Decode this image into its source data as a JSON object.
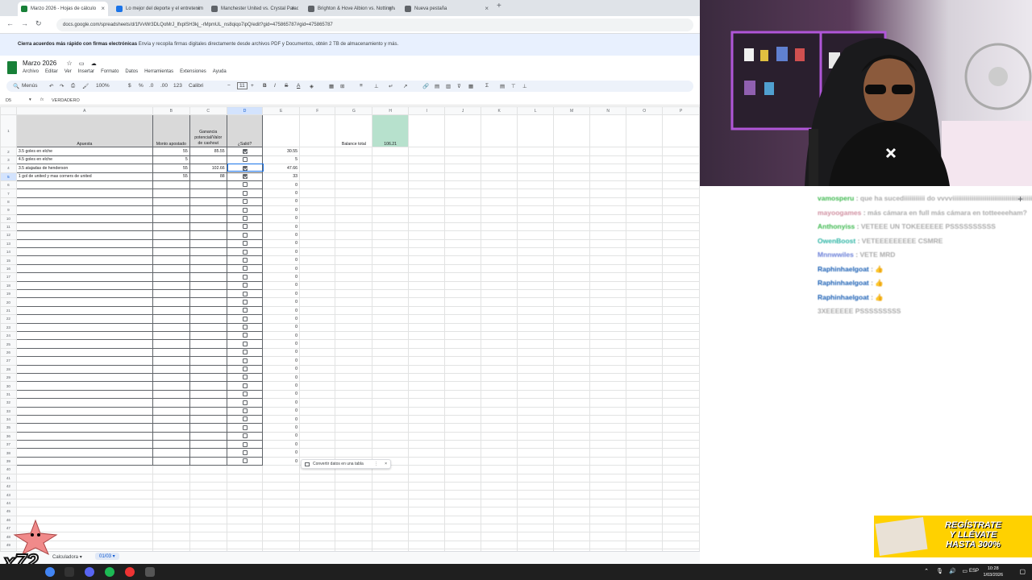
{
  "browser": {
    "tabs": [
      {
        "label": "Marzo 2026 - Hojas de cálculo",
        "active": true,
        "icon": "sheets-icon",
        "color": "#188038"
      },
      {
        "label": "Lo mejor del deporte y el entretenimiento",
        "active": false,
        "icon": "globe-icon",
        "color": "#1a73e8"
      },
      {
        "label": "Manchester United vs. Crystal Palace",
        "active": false,
        "icon": "globe-icon",
        "color": "#5f6368"
      },
      {
        "label": "Brighton & Hove Albion vs. Nottingham",
        "active": false,
        "icon": "globe-icon",
        "color": "#5f6368"
      },
      {
        "label": "Nueva pestaña",
        "active": false,
        "icon": "globe-icon",
        "color": "#5f6368"
      }
    ],
    "new_tab": "+",
    "url": "docs.google.com/spreadsheets/d/1fVvWr3DLQoMrJ_lfxplSH3kj_-rMpmUL_ns8qiqo7ipQ/edit?gid=475865787#gid=475865787"
  },
  "notice": {
    "bold": "Cierra acuerdos más rápido con firmas electrónicas",
    "text": "Envía y recopila firmas digitales directamente desde archivos PDF y Documentos, obtén 2 TB de almacenamiento y más."
  },
  "doc": {
    "title": "Marzo 2026",
    "menu": [
      "Archivo",
      "Editar",
      "Ver",
      "Insertar",
      "Formato",
      "Datos",
      "Herramientas",
      "Extensiones",
      "Ayuda"
    ]
  },
  "toolbar": {
    "menus": "Menús",
    "zoom": "100%",
    "currency": "$",
    "percent": "%",
    "fmt": "123",
    "font": "Calibri",
    "size": "11"
  },
  "formula": {
    "cell": "D5",
    "value": "VERDADERO"
  },
  "sheet": {
    "columns": [
      "A",
      "B",
      "C",
      "D",
      "E",
      "F",
      "G",
      "H",
      "I",
      "J",
      "K",
      "L",
      "M",
      "N",
      "O",
      "P"
    ],
    "headers": {
      "a": "Apuesta",
      "b": "Monto apostado",
      "c": "Ganancia potencial/Valor de cashout",
      "d": "¿Salió?"
    },
    "balance_label": "Balance total",
    "balance_value": "106.21",
    "bets": [
      {
        "a": "3.5 goles en elche",
        "b": "55",
        "c": "85.55",
        "checked": true,
        "e": "30.55"
      },
      {
        "a": "4.5 goles en elche",
        "b": "5",
        "c": "",
        "checked": false,
        "e": "5"
      },
      {
        "a": "3.5 atajadas de henderson",
        "b": "55",
        "c": "102.66",
        "checked": true,
        "e": "47.66"
      },
      {
        "a": "1 gol de united y mas corners de united",
        "b": "55",
        "c": "88",
        "checked": true,
        "e": "33"
      }
    ],
    "empty_e_value": "0",
    "last_table_row": 39,
    "visible_rows": 51
  },
  "popup": {
    "label": "Convertir datos en una tabla",
    "menu": "⋮",
    "close": "×"
  },
  "sheet_tabs": [
    {
      "label": "Calculadora",
      "active": false
    },
    {
      "label": "01/03",
      "active": true
    }
  ],
  "chat": [
    {
      "user": "vamosperu",
      "text": "que ha sucediiiiiiiiiii do vvvviiiiiiiiiiiiiiiiiiiiiiiiiiiiiiiiiiiiiiiiiiiiiiii",
      "color": "#3fb950"
    },
    {
      "user": "mayoogames",
      "text": "más cámara en full más cámara en totteeeeham?",
      "color": "#d08fa0"
    },
    {
      "user": "Anthonyiss",
      "text": "VETEEE UN TOKEEEEEE PSSSSSSSSSS",
      "color": "#3fb950"
    },
    {
      "user": "OwenBoost",
      "text": "VETEEEEEEEEE CSMRE",
      "color": "#2fb5a5"
    },
    {
      "user": "Mnnwwiles",
      "text": "VETE MRD",
      "color": "#6a7fd8"
    },
    {
      "user": "Raphinhaelgoat",
      "text": "👍",
      "color": "#1a5fb4"
    },
    {
      "user": "Raphinhaelgoat",
      "text": "👍",
      "color": "#1a5fb4"
    },
    {
      "user": "Raphinhaelgoat",
      "text": "👍",
      "color": "#1a5fb4"
    },
    {
      "user": "",
      "text": "3XEEEEEE PSSSSSSSSS",
      "color": "#999999"
    }
  ],
  "banner": {
    "line1": "REGÍSTRATE",
    "line2": "Y LLÉVATE",
    "line3": "HASTA 300%"
  },
  "overlay": {
    "multiplier": "x72"
  },
  "taskbar": {
    "lang": "ESP",
    "time": "10:28",
    "date": "1/03/2026"
  }
}
